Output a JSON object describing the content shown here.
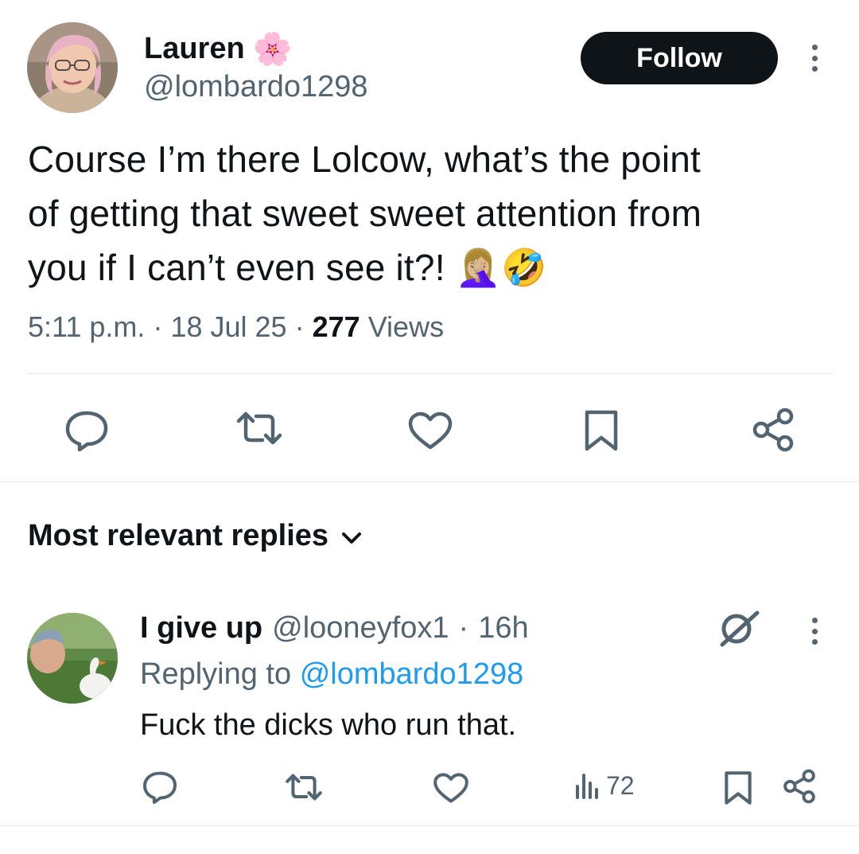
{
  "tweet": {
    "author_name": "Lauren",
    "author_emoji": "🌸",
    "author_handle": "@lombardo1298",
    "follow_label": "Follow",
    "text_lines": [
      "Course I’m there Lolcow, what’s the point",
      "of getting that sweet sweet attention from",
      "you if I can’t even see it?! 🤦🏼‍♀️🤣"
    ],
    "time": "5:11 p.m.",
    "date": "18 Jul 25",
    "views_count": "277",
    "views_label": "Views",
    "separator": "·"
  },
  "replies_section": {
    "title": "Most relevant replies"
  },
  "reply": {
    "author_name": "I give up",
    "author_handle": "@looneyfox1",
    "time_ago": "16h",
    "replying_to_label": "Replying to",
    "replying_to_handle": "@lombardo1298",
    "text": "Fuck the dicks who run that.",
    "views_count": "72"
  },
  "colors": {
    "text_primary": "#0f1419",
    "text_secondary": "#536471",
    "link": "#1d9bf0",
    "divider": "#e1e6ea",
    "follow_bg": "#0f1419"
  },
  "icons": [
    "reply-icon",
    "retweet-icon",
    "like-icon",
    "bookmark-icon",
    "share-icon",
    "more-icon",
    "views-icon",
    "grok-icon",
    "chevron-down-icon"
  ]
}
